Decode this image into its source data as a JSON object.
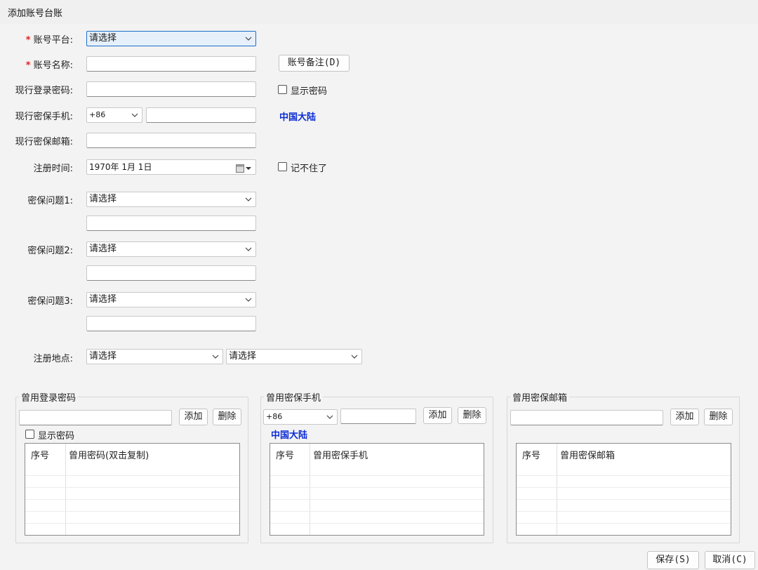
{
  "window": {
    "title": "添加账号台账"
  },
  "form": {
    "platform_label": "账号平台:",
    "platform_value": "请选择",
    "account_name_label": "账号名称:",
    "account_note_button": "账号备注(D)",
    "current_password_label": "现行登录密码:",
    "show_password_label": "显示密码",
    "phone_label": "现行密保手机:",
    "phone_country_code": "+86",
    "phone_region": "中国大陆",
    "email_label": "现行密保邮箱:",
    "register_time_label": "注册时间:",
    "register_time_value": "1970年 1月 1日",
    "forgot_label": "记不住了",
    "question1_label": "密保问题1:",
    "question1_value": "请选择",
    "question2_label": "密保问题2:",
    "question2_value": "请选择",
    "question3_label": "密保问题3:",
    "question3_value": "请选择",
    "location_label": "注册地点:",
    "location_province": "请选择",
    "location_city": "请选择"
  },
  "groups": {
    "passwords": {
      "title": "曾用登录密码",
      "add_button": "添加",
      "delete_button": "删除",
      "show_password_label": "显示密码",
      "columns": [
        "序号",
        "曾用密码(双击复制)"
      ]
    },
    "phones": {
      "title": "曾用密保手机",
      "country_code": "+86",
      "region": "中国大陆",
      "add_button": "添加",
      "delete_button": "删除",
      "columns": [
        "序号",
        "曾用密保手机"
      ]
    },
    "emails": {
      "title": "曾用密保邮箱",
      "add_button": "添加",
      "delete_button": "删除",
      "columns": [
        "序号",
        "曾用密保邮箱"
      ]
    }
  },
  "footer": {
    "save_button": "保存(S)",
    "cancel_button": "取消(C)"
  }
}
